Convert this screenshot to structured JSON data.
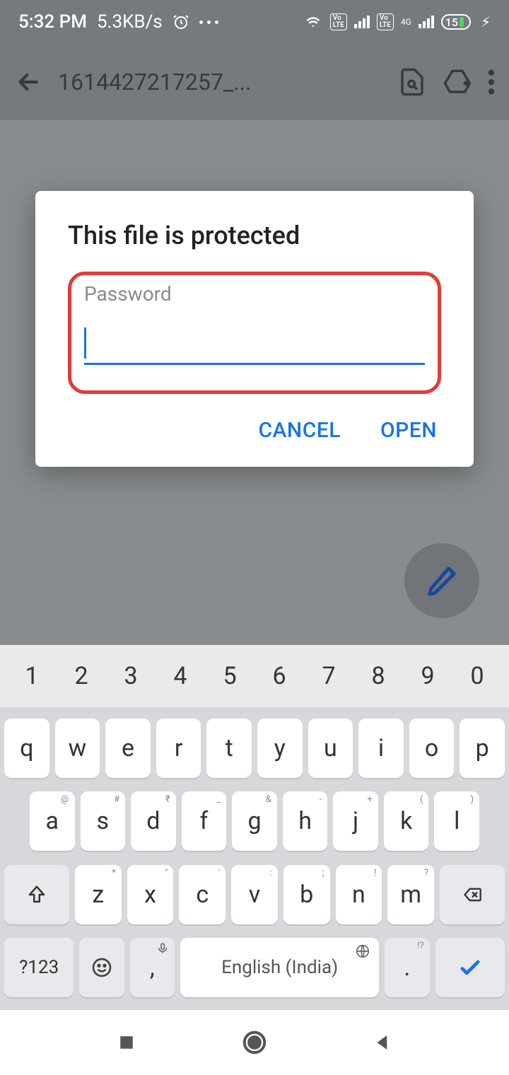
{
  "status": {
    "time": "5:32 PM",
    "speed": "5.3KB/s",
    "battery_pct": "15"
  },
  "appbar": {
    "title": "1614427217257_..."
  },
  "dialog": {
    "title": "This file is protected",
    "password_label": "Password",
    "password_value": "",
    "cancel": "CANCEL",
    "open": "OPEN"
  },
  "keyboard": {
    "numbers": [
      "1",
      "2",
      "3",
      "4",
      "5",
      "6",
      "7",
      "8",
      "9",
      "0"
    ],
    "row1": [
      "q",
      "w",
      "e",
      "r",
      "t",
      "y",
      "u",
      "i",
      "o",
      "p"
    ],
    "row2": [
      {
        "k": "a",
        "s": "@"
      },
      {
        "k": "s",
        "s": "#"
      },
      {
        "k": "d",
        "s": "₹"
      },
      {
        "k": "f",
        "s": "_"
      },
      {
        "k": "g",
        "s": "&"
      },
      {
        "k": "h",
        "s": "-"
      },
      {
        "k": "j",
        "s": "+"
      },
      {
        "k": "k",
        "s": "("
      },
      {
        "k": "l",
        "s": ")"
      }
    ],
    "row3": [
      {
        "k": "z",
        "s": "*"
      },
      {
        "k": "x",
        "s": "\""
      },
      {
        "k": "c",
        "s": "'"
      },
      {
        "k": "v",
        "s": ":"
      },
      {
        "k": "b",
        "s": ";"
      },
      {
        "k": "n",
        "s": "!"
      },
      {
        "k": "m",
        "s": "?"
      }
    ],
    "symkey": "?123",
    "comma": ",",
    "period": ".",
    "period_sup": "!?",
    "space_label": "English (India)"
  }
}
